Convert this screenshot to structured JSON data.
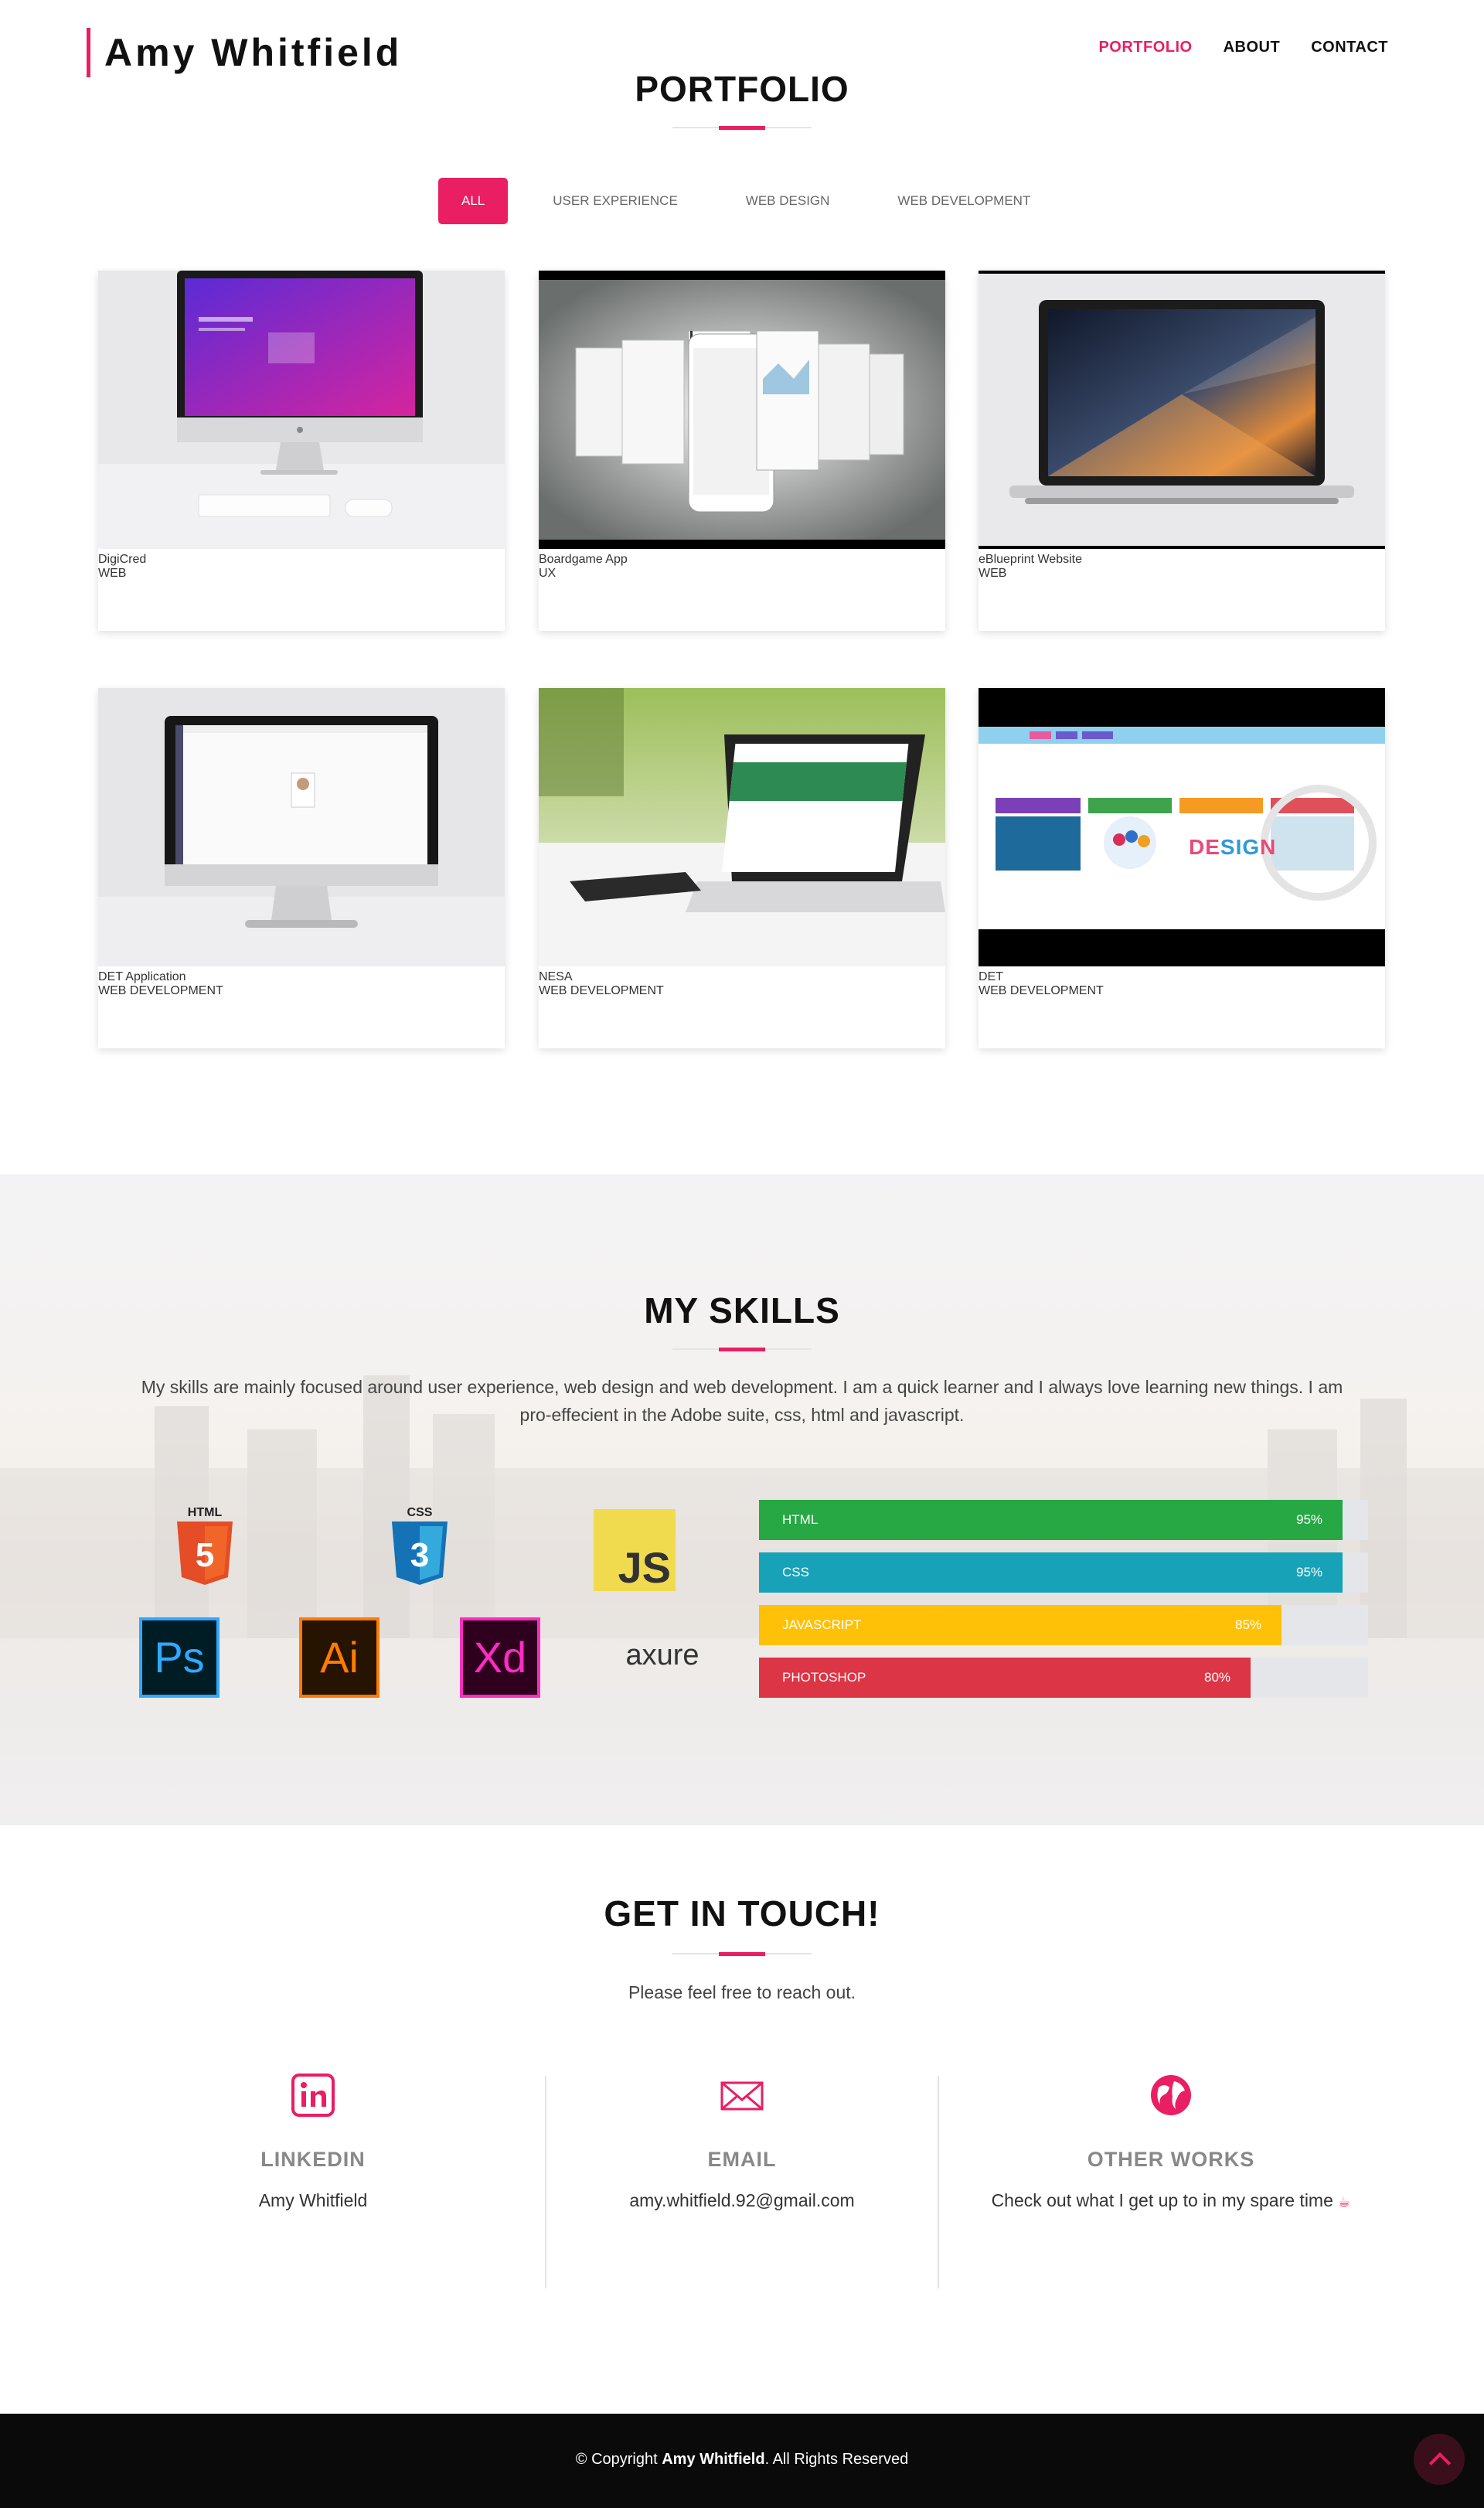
{
  "header": {
    "brand": "Amy Whitfield",
    "nav": [
      {
        "label": "PORTFOLIO",
        "active": true
      },
      {
        "label": "ABOUT",
        "active": false
      },
      {
        "label": "CONTACT",
        "active": false
      }
    ]
  },
  "portfolio": {
    "title": "PORTFOLIO",
    "filters": [
      "ALL",
      "USER EXPERIENCE",
      "WEB DESIGN",
      "WEB DEVELOPMENT"
    ],
    "active_filter": "ALL",
    "items": [
      {
        "name": "DigiCred",
        "category": "WEB"
      },
      {
        "name": "Boardgame App",
        "category": "UX"
      },
      {
        "name": "eBlueprint Website",
        "category": "WEB"
      },
      {
        "name": "DET Application",
        "category": "WEB DEVELOPMENT"
      },
      {
        "name": "NESA",
        "category": "WEB DEVELOPMENT"
      },
      {
        "name": "DET",
        "category": "WEB DEVELOPMENT"
      }
    ]
  },
  "skills": {
    "title": "MY SKILLS",
    "description": "My skills are mainly focused around user experience, web design and web development. I am a quick learner and I always love learning new things. I am pro-effecient in the Adobe suite, css, html and javascript.",
    "logos": {
      "html": "HTML",
      "css": "CSS",
      "js": "JS",
      "ps": "Ps",
      "ai": "Ai",
      "xd": "Xd",
      "axure": "axure"
    },
    "bars": [
      {
        "label": "HTML",
        "percent": "95%",
        "value": 95,
        "color": "#28a745"
      },
      {
        "label": "CSS",
        "percent": "95%",
        "value": 95,
        "color": "#17a2b8"
      },
      {
        "label": "JAVASCRIPT",
        "percent": "85%",
        "value": 85,
        "color": "#ffc107"
      },
      {
        "label": "PHOTOSHOP",
        "percent": "80%",
        "value": 80,
        "color": "#dc3545"
      }
    ]
  },
  "contact": {
    "title": "GET IN TOUCH!",
    "subtitle": "Please feel free to reach out.",
    "columns": [
      {
        "heading": "LINKEDIN",
        "value": "Amy Whitfield",
        "icon": "linkedin-icon"
      },
      {
        "heading": "EMAIL",
        "value": "amy.whitfield.92@gmail.com",
        "icon": "envelope-icon"
      },
      {
        "heading": "OTHER WORKS",
        "value": "Check out what I get up to in my spare time",
        "icon": "globe-icon"
      }
    ]
  },
  "footer": {
    "prefix": "© Copyright ",
    "name": "Amy Whitfield",
    "suffix": ". All Rights Reserved"
  },
  "colors": {
    "accent": "#e91e63"
  }
}
